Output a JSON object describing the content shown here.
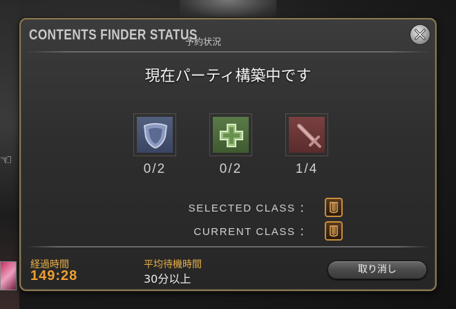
{
  "window": {
    "title_en": "CONTENTS FINDER STATUS",
    "title_jp": "予約状況"
  },
  "status_message": "現在パーティ構築中です",
  "roles": [
    {
      "role": "tank",
      "icon": "shield-icon",
      "count": "0/2"
    },
    {
      "role": "healer",
      "icon": "cross-icon",
      "count": "0/2"
    },
    {
      "role": "dps",
      "icon": "sword-icon",
      "count": "1/4"
    }
  ],
  "class_info": {
    "selected_label": "SELECTED CLASS ：",
    "current_label": "CURRENT CLASS ：",
    "class_icon": "archer-quiver-icon"
  },
  "footer": {
    "elapsed_label": "経過時間",
    "elapsed_value": "149:28",
    "avg_label": "平均待機時間",
    "avg_value": "30分以上",
    "cancel_label": "取り消し"
  },
  "colors": {
    "frame_gold": "#8a7a55",
    "time_orange": "#f0a030",
    "label_orange": "#e8b048"
  }
}
